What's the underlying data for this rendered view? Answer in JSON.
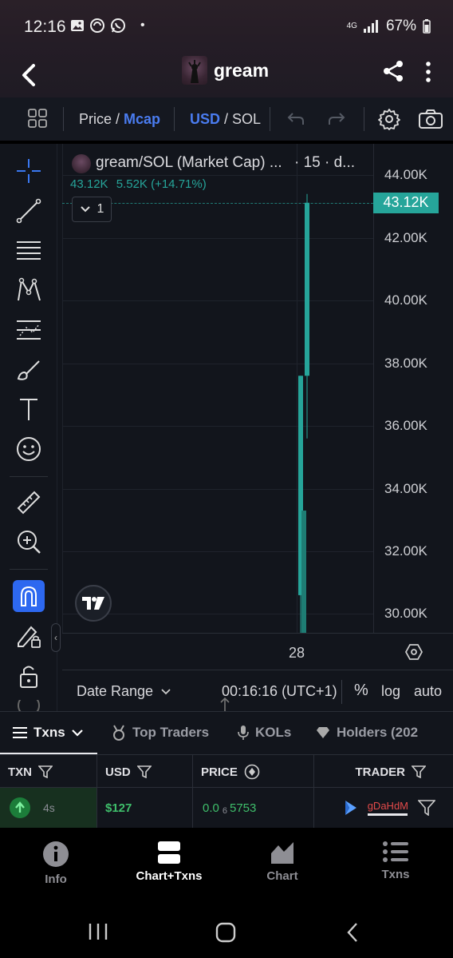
{
  "status_bar": {
    "time": "12:16",
    "dot": "•",
    "network": "4G",
    "battery": "67%"
  },
  "header": {
    "title": "gream"
  },
  "toolbar": {
    "price_label": "Price",
    "separator": " / ",
    "mcap_label": "Mcap",
    "usd_label": "USD",
    "sol_label": "SOL"
  },
  "chart": {
    "legend_title": "gream/SOL (Market Cap) ...",
    "legend_interval": "· 15 · d...",
    "last_value": "43.12K",
    "change": "5.52K (+14.71%)",
    "collapse_count": "1",
    "price_tag": "43.12K",
    "x_tick": "28",
    "date_range_label": "Date Range",
    "clock": "00:16:16 (UTC+1)",
    "percent_label": "%",
    "log_label": "log",
    "auto_label": "auto"
  },
  "chart_data": {
    "type": "candlestick",
    "title": "gream/SOL (Market Cap)",
    "y_ticks": [
      "44.00K",
      "42.00K",
      "40.00K",
      "38.00K",
      "36.00K",
      "34.00K",
      "32.00K",
      "30.00K"
    ],
    "ylim": [
      29.4,
      45
    ],
    "x_ticks": [
      "28"
    ],
    "candles": [
      {
        "open": 30.6,
        "close": 37.6,
        "high": 37.6,
        "low": 29.4,
        "color": "#26a59a"
      },
      {
        "open": 29.4,
        "close": 33.3,
        "high": 33.3,
        "low": 29.4,
        "color": "#1e7d74"
      },
      {
        "open": 37.6,
        "close": 43.12,
        "high": 43.4,
        "low": 35.6,
        "color": "#26a59a"
      }
    ],
    "last": 43.12,
    "grid": true
  },
  "tabs": {
    "txns": "Txns",
    "top_traders": "Top Traders",
    "kols": "KOLs",
    "holders": "Holders (202"
  },
  "table": {
    "headers": {
      "txn": "TXN",
      "usd": "USD",
      "price": "PRICE",
      "trader": "TRADER"
    },
    "rows": [
      {
        "age": "4s",
        "usd": "$127",
        "price_prefix": "0.0",
        "price_sub": "6",
        "price_rest": "5753",
        "trader": "gDaHdM"
      }
    ]
  },
  "bottom_nav": {
    "info": "Info",
    "chart_txns": "Chart+Txns",
    "chart": "Chart",
    "txns": "Txns"
  },
  "colors": {
    "accent_blue": "#4a7cf0",
    "green": "#26a59a",
    "buy_green": "#3fbf6b",
    "red": "#e34a4a"
  }
}
